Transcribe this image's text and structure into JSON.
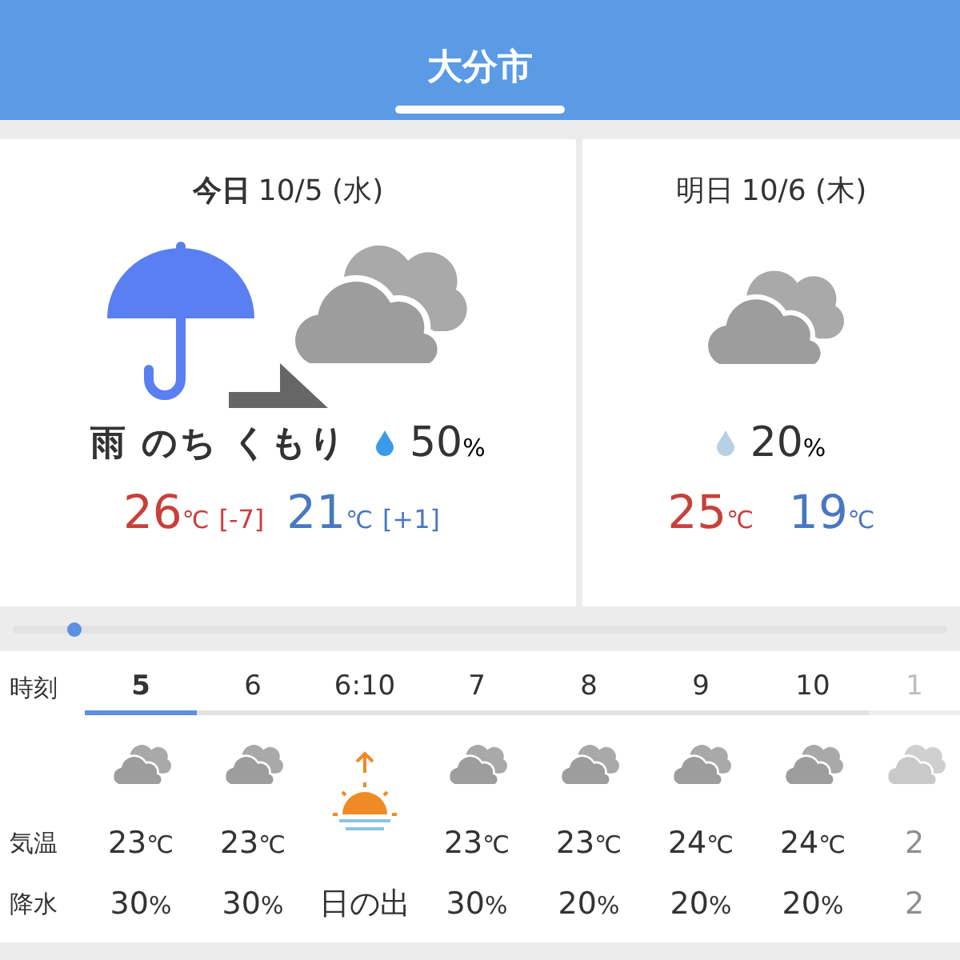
{
  "header": {
    "title": "大分市"
  },
  "days": [
    {
      "label": "今日",
      "date": "10/5 (水)",
      "today": true,
      "kind": "rain_then_cloudy",
      "condition": "雨 のち くもり",
      "rain": {
        "value": "50",
        "unit": "%"
      },
      "high": {
        "value": "26",
        "unit": "℃",
        "diff": "[-7]"
      },
      "low": {
        "value": "21",
        "unit": "℃",
        "diff": "[+1]"
      }
    },
    {
      "label": "明日",
      "date": "10/6 (木)",
      "today": false,
      "kind": "cloudy",
      "rain": {
        "value": "20",
        "unit": "%"
      },
      "high": {
        "value": "25",
        "unit": "℃"
      },
      "low": {
        "value": "19",
        "unit": "℃"
      }
    }
  ],
  "hourly": {
    "labels": [
      "時刻",
      "気温",
      "降水"
    ],
    "columns": [
      {
        "hour": "5",
        "selected": true,
        "kind": "cloudy",
        "temp": {
          "value": "23",
          "unit": "℃"
        },
        "precip": {
          "value": "30",
          "unit": "%"
        }
      },
      {
        "hour": "6",
        "selected": false,
        "kind": "cloudy",
        "temp": {
          "value": "23",
          "unit": "℃"
        },
        "precip": {
          "value": "30",
          "unit": "%"
        }
      },
      {
        "hour": "6:10",
        "selected": false,
        "kind": "sunrise",
        "precip": {
          "value": "日の出"
        }
      },
      {
        "hour": "7",
        "selected": false,
        "kind": "cloudy",
        "temp": {
          "value": "23",
          "unit": "℃"
        },
        "precip": {
          "value": "30",
          "unit": "%"
        }
      },
      {
        "hour": "8",
        "selected": false,
        "kind": "cloudy",
        "temp": {
          "value": "23",
          "unit": "℃"
        },
        "precip": {
          "value": "20",
          "unit": "%"
        }
      },
      {
        "hour": "9",
        "selected": false,
        "kind": "cloudy",
        "temp": {
          "value": "24",
          "unit": "℃"
        },
        "precip": {
          "value": "20",
          "unit": "%"
        }
      },
      {
        "hour": "10",
        "selected": false,
        "kind": "cloudy",
        "temp": {
          "value": "24",
          "unit": "℃"
        },
        "precip": {
          "value": "20",
          "unit": "%"
        }
      },
      {
        "hour": "1",
        "selected": false,
        "faded": true,
        "kind": "cloudy",
        "temp": {
          "value": "2"
        },
        "precip": {
          "value": "2"
        }
      }
    ]
  }
}
